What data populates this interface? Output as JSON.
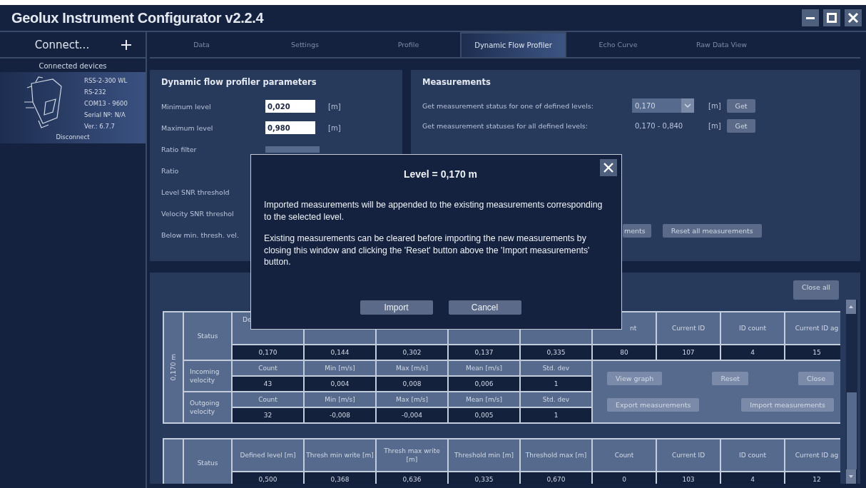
{
  "window": {
    "title": "Geolux Instrument Configurator v2.2.4"
  },
  "sidebar": {
    "connect": "Connect...",
    "connected_header": "Connected devices",
    "device_lines": [
      "RSS-2-300 WL",
      "RS-232",
      "COM13 - 9600",
      "Serial Nº: N/A",
      "Ver.: 6.7.7"
    ],
    "disconnect": "Disconnect"
  },
  "tabs": [
    {
      "label": "Data",
      "selected": false
    },
    {
      "label": "Settings",
      "selected": false
    },
    {
      "label": "Profile",
      "selected": false
    },
    {
      "label": "Dynamic Flow Profiler",
      "selected": true
    },
    {
      "label": "Echo Curve",
      "selected": false
    },
    {
      "label": "Raw Data View",
      "selected": false
    }
  ],
  "parameters": {
    "title": "Dynamic flow profiler parameters",
    "rows": [
      {
        "kind": "input",
        "label": "Minimum level",
        "value": "0,020",
        "unit": "[m]"
      },
      {
        "kind": "input",
        "label": "Maximum level",
        "value": "0,980",
        "unit": "[m]"
      },
      {
        "kind": "dropdown",
        "label": "Ratio filter"
      },
      {
        "kind": "label",
        "label": "Ratio"
      },
      {
        "kind": "label",
        "label": "Level SNR threshold"
      },
      {
        "kind": "label",
        "label": "Velocity SNR threshol"
      },
      {
        "kind": "label",
        "label": "Below min. thresh. vel."
      }
    ]
  },
  "measurements": {
    "title": "Measurements",
    "rows": [
      {
        "kind": "select",
        "label": "Get measurement status for one of defined levels:",
        "value": "0,170",
        "unit": "[m]",
        "button": "Get"
      },
      {
        "kind": "range",
        "label": "Get measurement statuses for all defined levels:",
        "value": "0,170 - 0,840",
        "unit": "[m]",
        "button": "Get"
      }
    ],
    "buttons": [
      "ments",
      "Reset all measurements"
    ]
  },
  "levels": {
    "close_all": "Close all",
    "tables": [
      {
        "side_label": "0,170 m",
        "status_label": "Status",
        "header_left": [
          "De"
        ],
        "header_right": [
          "nt",
          "Current ID",
          "ID count",
          "Current ID ag"
        ],
        "values": [
          "0,170",
          "0,144",
          "0,302",
          "0,137",
          "0,335",
          "80",
          "107",
          "4",
          "15"
        ],
        "velocity": [
          {
            "label": "Incoming velocity",
            "header": [
              "Count",
              "Min [m/s]",
              "Max [m/s]",
              "Mean [m/s]",
              "Std. dev"
            ],
            "values": [
              "43",
              "0,004",
              "0,008",
              "0,006",
              "1"
            ]
          },
          {
            "label": "Outgoing velocity",
            "header": [
              "Count",
              "Min [m/s]",
              "Max [m/s]",
              "Mean [m/s]",
              "Std. dev"
            ],
            "values": [
              "32",
              "-0,008",
              "-0,004",
              "0,005",
              "1"
            ]
          }
        ],
        "actions": [
          "View graph",
          "Reset",
          "Close",
          "Export measurements",
          "Import measurements"
        ]
      },
      {
        "status_label": "Status",
        "header": [
          "Defined level [m]",
          "Thresh min write [m]",
          "Thresh max write [m]",
          "Threshold min [m]",
          "Threshold max [m]",
          "Count",
          "Current ID",
          "ID count",
          "Current ID ag"
        ],
        "values": [
          "0,500",
          "0,368",
          "0,636",
          "0,335",
          "0,670",
          "0",
          "103",
          "4",
          "12"
        ]
      }
    ]
  },
  "dialog": {
    "title": "Level = 0,170 m",
    "paragraphs": [
      "Imported measurements will be appended to the existing measurements corresponding to the selected level.",
      "Existing measurements can be cleared before importing the new measurements by closing this window and clicking the 'Reset' button above the 'Import measurements' button."
    ],
    "buttons": [
      "Import",
      "Cancel"
    ]
  }
}
